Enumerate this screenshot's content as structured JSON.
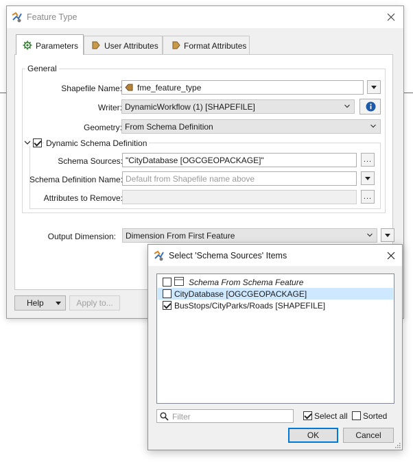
{
  "main_dialog": {
    "title": "Feature Type",
    "tabs": [
      {
        "label": "Parameters"
      },
      {
        "label": "User Attributes"
      },
      {
        "label": "Format Attributes"
      }
    ],
    "general": {
      "title": "General",
      "shapefile_name_label": "Shapefile Name:",
      "shapefile_name_value": "fme_feature_type",
      "writer_label": "Writer:",
      "writer_value": "DynamicWorkflow (1) [SHAPEFILE]",
      "geometry_label": "Geometry:",
      "geometry_value": "From Schema Definition",
      "dynamic_schema": {
        "title": "Dynamic Schema Definition",
        "checked": true,
        "schema_sources_label": "Schema Sources:",
        "schema_sources_value": "\"CityDatabase [OGCGEOPACKAGE]\"",
        "schema_def_name_label": "Schema Definition Name:",
        "schema_def_name_placeholder": "Default from Shapefile name above",
        "attributes_remove_label": "Attributes to Remove:",
        "attributes_remove_value": ""
      }
    },
    "output_dimension_label": "Output Dimension:",
    "output_dimension_value": "Dimension From First Feature",
    "help_label": "Help",
    "apply_label": "Apply to..."
  },
  "schema_dialog": {
    "title": "Select 'Schema Sources' Items",
    "items": [
      {
        "label": "Schema From Schema Feature",
        "checked": false,
        "italic": true
      },
      {
        "label": "CityDatabase [OGCGEOPACKAGE]",
        "checked": false,
        "selected": true
      },
      {
        "label": "BusStops/CityParks/Roads [SHAPEFILE]",
        "checked": true
      }
    ],
    "filter_placeholder": "Filter",
    "select_all_label": "Select all",
    "select_all_checked": true,
    "sorted_label": "Sorted",
    "sorted_checked": false,
    "ok_label": "OK",
    "cancel_label": "Cancel"
  },
  "colors": {
    "dialog_bg": "#f0f0f0",
    "selection": "#cde8ff",
    "accent": "#0078d7",
    "info_button": "#1e5aa8",
    "reader_arrow": "#b5833a"
  },
  "icons": {
    "app": "fme-app-icon",
    "parameters": "gear-icon",
    "user_attributes": "arrow-tag-icon",
    "format_attributes": "arrow-tag-icon",
    "writer_info": "info-icon",
    "filter": "search-icon"
  }
}
